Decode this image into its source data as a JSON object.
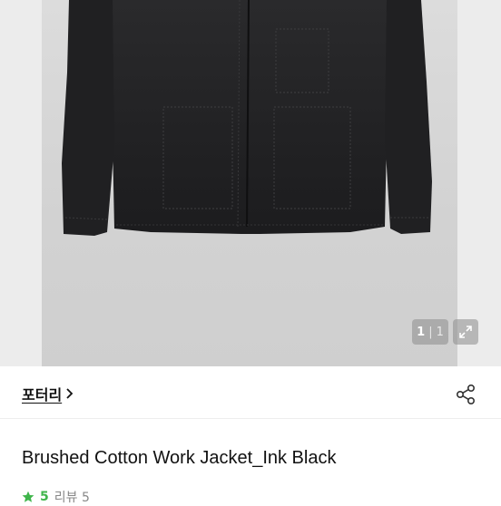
{
  "gallery": {
    "current_index": "1",
    "separator": "|",
    "total": "1",
    "expand_icon": "expand-icon"
  },
  "shop": {
    "name": "포터리",
    "chevron": "›"
  },
  "product": {
    "title": "Brushed Cotton Work Jacket_Ink Black",
    "rating_score": "5",
    "review_label": "리뷰 5"
  },
  "colors": {
    "accent_green": "#3fb54b",
    "jacket": "#1f1f21"
  }
}
